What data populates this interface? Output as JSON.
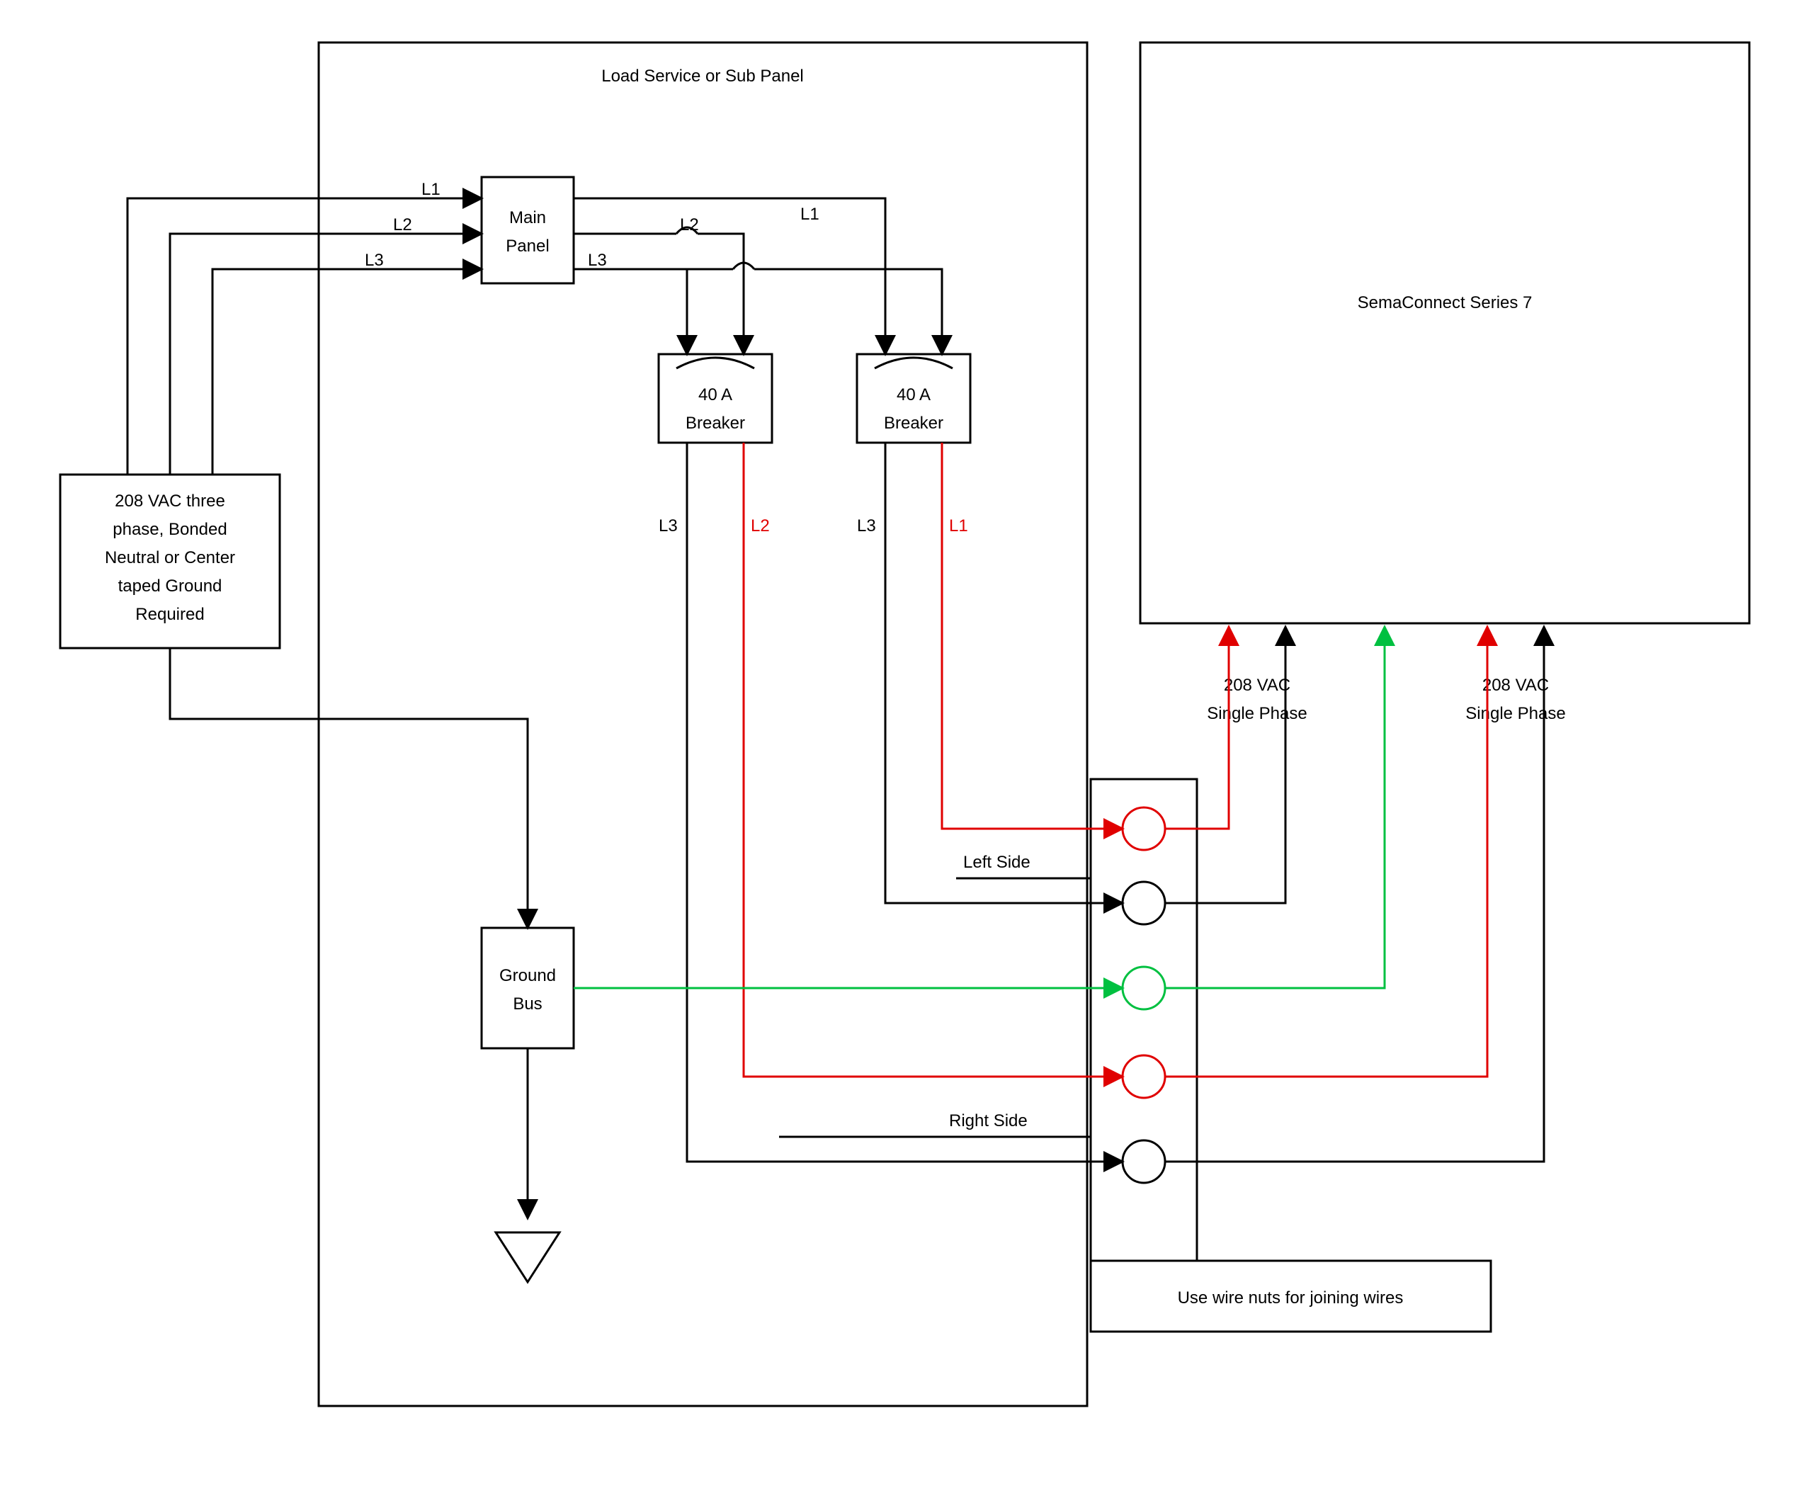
{
  "title_panel": "Load Service or Sub Panel",
  "source_box": {
    "line1": "208 VAC three",
    "line2": "phase, Bonded",
    "line3": "Neutral or Center",
    "line4": "taped Ground",
    "line5": "Required"
  },
  "main_panel": {
    "line1": "Main",
    "line2": "Panel"
  },
  "breaker_left": {
    "line1": "40 A",
    "line2": "Breaker"
  },
  "breaker_right": {
    "line1": "40 A",
    "line2": "Breaker"
  },
  "ground_bus": {
    "line1": "Ground",
    "line2": "Bus"
  },
  "sema": "SemaConnect Series 7",
  "phase_left": {
    "line1": "208 VAC",
    "line2": "Single Phase"
  },
  "phase_right": {
    "line1": "208 VAC",
    "line2": "Single Phase"
  },
  "left_side": "Left Side",
  "right_side": "Right Side",
  "wire_note": "Use wire nuts for joining wires",
  "wires": {
    "l1_in": "L1",
    "l2_in": "L2",
    "l3_in": "L3",
    "l1_out": "L1",
    "l2_out": "L2",
    "l3_out": "L3",
    "brk_left_l3": "L3",
    "brk_left_l2": "L2",
    "brk_right_l3": "L3",
    "brk_right_l1": "L1"
  }
}
